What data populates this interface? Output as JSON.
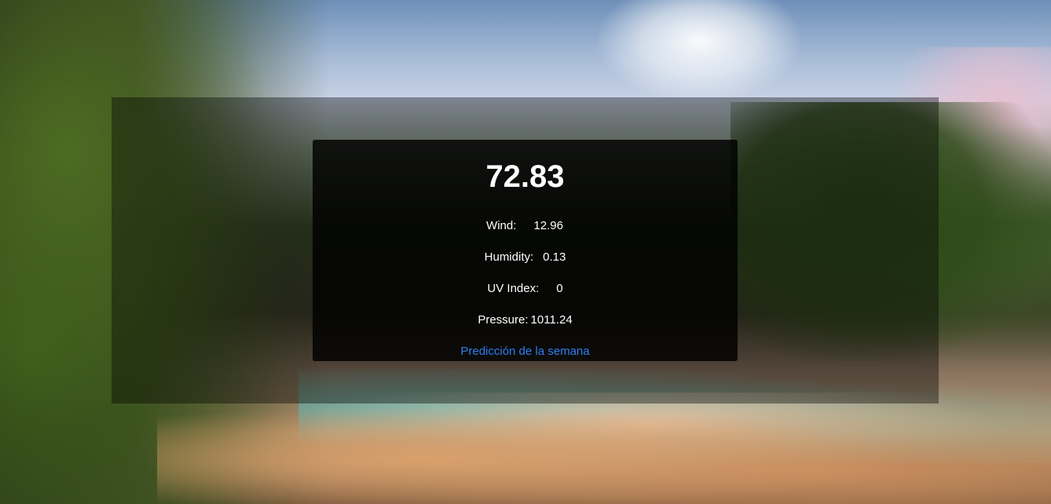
{
  "weather": {
    "temperature": "72.83",
    "wind": {
      "label": "Wind:",
      "value": "12.96"
    },
    "humidity": {
      "label": "Humidity:",
      "value": "0.13"
    },
    "uv_index": {
      "label": "UV Index:",
      "value": "0"
    },
    "pressure": {
      "label": "Pressure:",
      "value": "1011.24"
    },
    "forecast_link": "Predicción de la semana"
  },
  "colors": {
    "link": "#2e7ef0",
    "card_background": "#000000",
    "text": "#ffffff"
  }
}
